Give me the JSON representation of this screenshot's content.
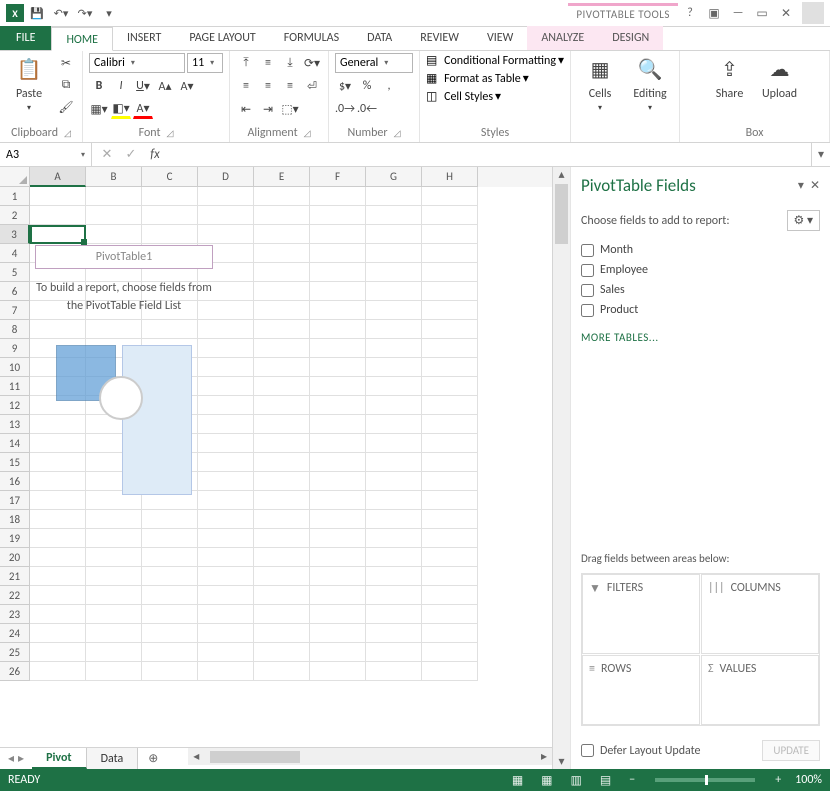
{
  "titlebar": {
    "context_tool_label": "PIVOTTABLE TOOLS"
  },
  "tabs": {
    "file": "FILE",
    "home": "HOME",
    "insert": "INSERT",
    "page_layout": "PAGE LAYOUT",
    "formulas": "FORMULAS",
    "data": "DATA",
    "review": "REVIEW",
    "view": "VIEW",
    "analyze": "ANALYZE",
    "design": "DESIGN"
  },
  "ribbon": {
    "clipboard": {
      "label": "Clipboard",
      "paste": "Paste"
    },
    "font": {
      "label": "Font",
      "family": "Calibri",
      "size": "11"
    },
    "alignment": {
      "label": "Alignment"
    },
    "number": {
      "label": "Number",
      "format": "General"
    },
    "styles": {
      "label": "Styles",
      "conditional": "Conditional Formatting",
      "as_table": "Format as Table",
      "cell_styles": "Cell Styles"
    },
    "cells": {
      "label": "Cells"
    },
    "editing": {
      "label": "Editing"
    },
    "box": {
      "label": "Box",
      "share": "Share",
      "upload": "Upload"
    }
  },
  "name_box": {
    "value": "A3"
  },
  "columns": [
    "A",
    "B",
    "C",
    "D",
    "E",
    "F",
    "G",
    "H"
  ],
  "selected_col": "A",
  "selected_row": 3,
  "row_count": 26,
  "pivot_placeholder": {
    "name": "PivotTable1",
    "hint": "To build a report, choose fields from the PivotTable Field List"
  },
  "sheet_tabs": {
    "active": "Pivot",
    "other": "Data"
  },
  "pane": {
    "title": "PivotTable Fields",
    "choose_label": "Choose fields to add to report:",
    "fields": [
      "Month",
      "Employee",
      "Sales",
      "Product"
    ],
    "more_tables": "MORE TABLES...",
    "drag_label": "Drag fields between areas below:",
    "areas": {
      "filters": "FILTERS",
      "columns": "COLUMNS",
      "rows": "ROWS",
      "values": "VALUES"
    },
    "defer": "Defer Layout Update",
    "update": "UPDATE"
  },
  "status": {
    "ready": "READY",
    "zoom": "100%"
  }
}
